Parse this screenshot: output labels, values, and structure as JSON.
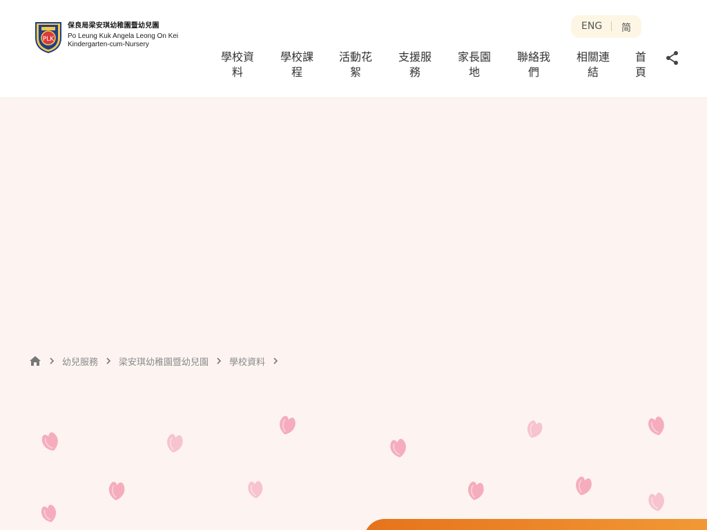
{
  "header": {
    "logo": {
      "name_zh": "保良局梁安琪幼稚園暨幼兒園",
      "name_en_line1": "Po Leung Kuk Angela Leong On Kei",
      "name_en_line2": "Kindergarten-cum-Nursery"
    },
    "lang": {
      "eng": "ENG",
      "sc": "简"
    },
    "nav": [
      {
        "line1": "學校資",
        "line2": "料"
      },
      {
        "line1": "學校課",
        "line2": "程"
      },
      {
        "line1": "活動花",
        "line2": "絮"
      },
      {
        "line1": "支援服",
        "line2": "務"
      },
      {
        "line1": "家長園",
        "line2": "地"
      },
      {
        "line1": "聯絡我",
        "line2": "們"
      },
      {
        "line1": "相關連",
        "line2": "結"
      },
      {
        "line1": "首",
        "line2": "頁"
      }
    ]
  },
  "breadcrumb": [
    "幼兒服務",
    "梁安琪幼稚園暨幼兒園",
    "學校資料"
  ],
  "colors": {
    "page_bg": "#fdf4f2",
    "accent_orange": "#e6731b",
    "lang_bg": "#fdf6e4",
    "petal": "#f29bb0"
  },
  "icons": [
    "home-icon",
    "chevron-right-icon",
    "share-icon",
    "petal-icon"
  ]
}
